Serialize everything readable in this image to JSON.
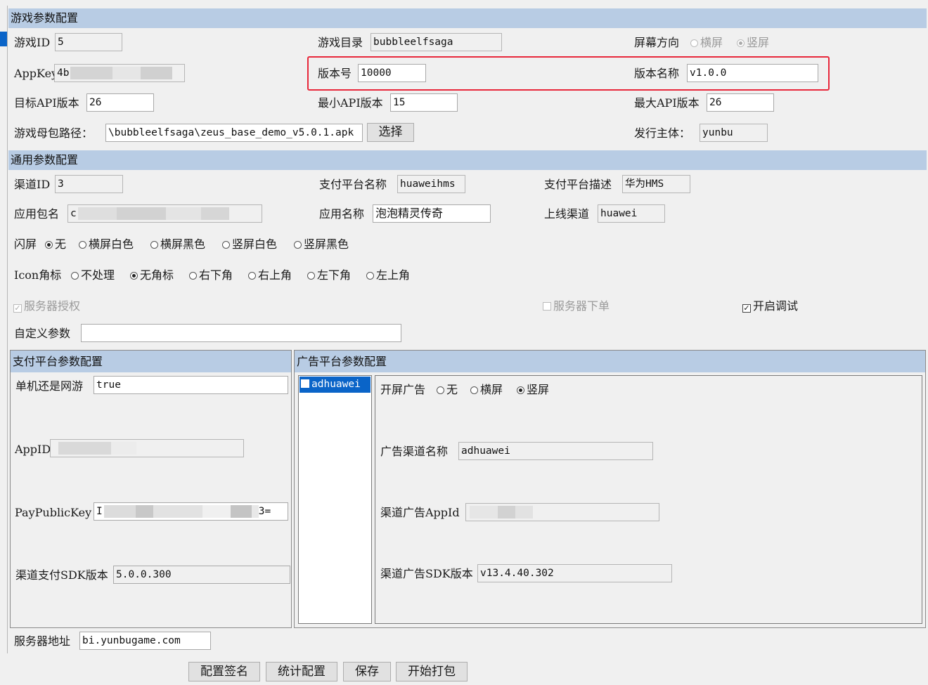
{
  "game_section": {
    "title": "游戏参数配置",
    "game_id_label": "游戏ID",
    "game_id": "5",
    "game_dir_label": "游戏目录",
    "game_dir": "bubbleelfsaga",
    "orientation_label": "屏幕方向",
    "orientation_options": [
      "横屏",
      "竖屏"
    ],
    "orientation_selected": "竖屏",
    "appkey_label": "AppKey",
    "appkey_visible": "4b",
    "version_code_label": "版本号",
    "version_code": "10000",
    "version_name_label": "版本名称",
    "version_name": "v1.0.0",
    "target_api_label": "目标API版本",
    "target_api": "26",
    "min_api_label": "最小API版本",
    "min_api": "15",
    "max_api_label": "最大API版本",
    "max_api": "26",
    "base_apk_label": "游戏母包路径：",
    "base_apk_path": "\\bubbleelfsaga\\zeus_base_demo_v5.0.1.apk",
    "choose_button": "选择",
    "publisher_label": "发行主体：",
    "publisher": "yunbu"
  },
  "common_section": {
    "title": "通用参数配置",
    "channel_id_label": "渠道ID",
    "channel_id": "3",
    "pay_platform_name_label": "支付平台名称",
    "pay_platform_name": "huaweihms",
    "pay_platform_desc_label": "支付平台描述",
    "pay_platform_desc": "华为HMS",
    "package_label": "应用包名",
    "package_visible": "c",
    "app_name_label": "应用名称",
    "app_name": "泡泡精灵传奇",
    "online_channel_label": "上线渠道",
    "online_channel": "huawei",
    "splash_label": "闪屏",
    "splash_options": [
      "无",
      "横屏白色",
      "横屏黑色",
      "竖屏白色",
      "竖屏黑色"
    ],
    "splash_selected": "无",
    "icon_badge_label": "Icon角标",
    "icon_badge_options": [
      "不处理",
      "无角标",
      "右下角",
      "右上角",
      "左下角",
      "左上角"
    ],
    "icon_badge_selected": "无角标",
    "server_auth_label": "服务器授权",
    "server_order_label": "服务器下单",
    "debug_label": "开启调试",
    "custom_params_label": "自定义参数",
    "custom_params": ""
  },
  "pay_section": {
    "title": "支付平台参数配置",
    "mode_label": "单机还是网游",
    "mode": "true",
    "appid_label": "AppID",
    "paykey_label": "PayPublicKey",
    "paykey_prefix": "I",
    "paykey_suffix": "3=",
    "sdk_version_label": "渠道支付SDK版本",
    "sdk_version": "5.0.0.300"
  },
  "ad_section": {
    "title": "广告平台参数配置",
    "list_items": [
      "adhuawei"
    ],
    "splash_ad_label": "开屏广告",
    "splash_ad_options": [
      "无",
      "横屏",
      "竖屏"
    ],
    "splash_ad_selected": "竖屏",
    "ad_channel_name_label": "广告渠道名称",
    "ad_channel_name": "adhuawei",
    "ad_appid_label": "渠道广告AppId",
    "ad_sdk_version_label": "渠道广告SDK版本",
    "ad_sdk_version": "v13.4.40.302"
  },
  "footer": {
    "server_addr_label": "服务器地址",
    "server_addr": "bi.yunbugame.com",
    "buttons": [
      "配置签名",
      "统计配置",
      "保存",
      "开始打包"
    ]
  },
  "colors": {
    "section_header": "#b8cce4",
    "highlight_box": "#e8283b",
    "selection": "#0a64c8"
  }
}
